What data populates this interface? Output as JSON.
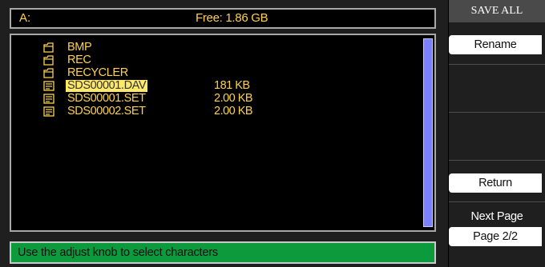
{
  "header": {
    "drive": "A:",
    "free_space": "Free: 1.86 GB"
  },
  "files": [
    {
      "type": "folder",
      "icon": "folder-icon",
      "name": "BMP",
      "size": ""
    },
    {
      "type": "folder",
      "icon": "folder-icon",
      "name": "REC",
      "size": ""
    },
    {
      "type": "folder",
      "icon": "folder-icon",
      "name": "RECYCLER",
      "size": ""
    },
    {
      "type": "file",
      "icon": "file-icon",
      "name": "SDS00001.DAV",
      "size": "181 KB",
      "selected": true
    },
    {
      "type": "file",
      "icon": "file-icon",
      "name": "SDS00001.SET",
      "size": "2.00 KB"
    },
    {
      "type": "file",
      "icon": "file-icon",
      "name": "SDS00002.SET",
      "size": "2.00 KB"
    }
  ],
  "status": {
    "message": "Use the adjust knob to select characters"
  },
  "menu": {
    "title": "SAVE ALL",
    "rename": "Rename",
    "return": "Return",
    "next_page_caption": "Next Page",
    "page_indicator": "Page 2/2"
  },
  "colors": {
    "text_yellow": "#ffd24a",
    "selection": "#ffe96a",
    "status_green": "#0c9a3c",
    "scrollbar": "#7a80ff"
  }
}
